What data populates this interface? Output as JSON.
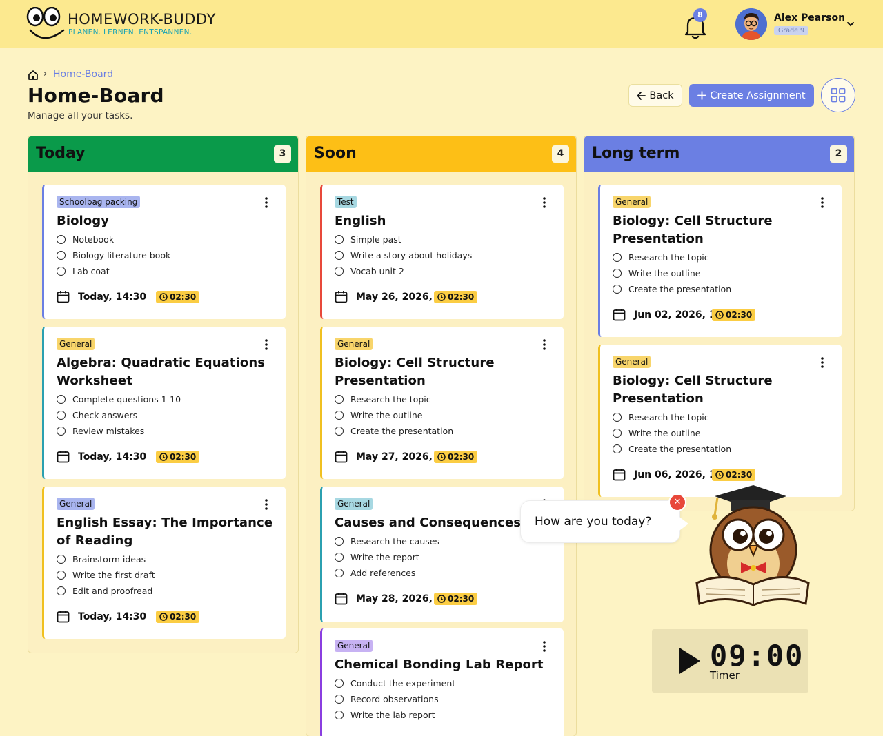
{
  "header": {
    "app_title": "HOMEWORK-BUDDY",
    "tagline": "PLANEN. LERNEN. ENTSPANNEN.",
    "notification_count": "8",
    "user_name": "Alex Pearson",
    "user_grade": "Grade 9"
  },
  "breadcrumb": {
    "current": "Home-Board"
  },
  "page": {
    "title": "Home-Board",
    "subtitle": "Manage all your tasks."
  },
  "actions": {
    "back_label": "Back",
    "create_label": "Create Assignment"
  },
  "colors": {
    "accent": "#6b7fe3",
    "today": "#0a9a4a",
    "soon": "#fdbf16",
    "long_term": "#6b7fe3",
    "duration_badge": "#fbcd44"
  },
  "columns": [
    {
      "title": "Today",
      "count": "3",
      "cards": [
        {
          "tag": "Schoolbag packing",
          "title": "Biology",
          "subtasks": [
            "Notebook",
            "Biology literature book",
            "Lab coat"
          ],
          "due": "Today, 14:30",
          "duration": "02:30"
        },
        {
          "tag": "General",
          "title": "Algebra: Quadratic Equations Worksheet",
          "subtasks": [
            "Complete questions 1-10",
            "Check answers",
            "Review mistakes"
          ],
          "due": "Today, 14:30",
          "duration": "02:30"
        },
        {
          "tag": "General",
          "title": "English Essay: The Importance of Reading",
          "subtasks": [
            "Brainstorm ideas",
            "Write the first draft",
            "Edit and proofread"
          ],
          "due": "Today, 14:30",
          "duration": "02:30"
        }
      ]
    },
    {
      "title": "Soon",
      "count": "4",
      "cards": [
        {
          "tag": "Test",
          "title": "English",
          "subtasks": [
            "Simple past",
            "Write a story about holidays",
            "Vocab unit 2"
          ],
          "due": "May 26, 2026, 14:30",
          "duration": "02:30"
        },
        {
          "tag": "General",
          "title": "Biology: Cell Structure Presentation",
          "subtasks": [
            "Research the topic",
            "Write the outline",
            "Create the presentation"
          ],
          "due": "May 27, 2026, 14:30",
          "duration": "02:30"
        },
        {
          "tag": "General",
          "title": "Causes and Consequences Report",
          "subtasks": [
            "Research the causes",
            "Write the report",
            "Add references"
          ],
          "due": "May 28, 2026, 14:30",
          "duration": "02:30"
        },
        {
          "tag": "General",
          "title": "Chemical Bonding Lab Report",
          "subtasks": [
            "Conduct the experiment",
            "Record observations",
            "Write the lab report"
          ]
        }
      ]
    },
    {
      "title": "Long term",
      "count": "2",
      "cards": [
        {
          "tag": "General",
          "title": "Biology: Cell Structure Presentation",
          "subtasks": [
            "Research the topic",
            "Write the outline",
            "Create the presentation"
          ],
          "due": "Jun 02, 2026, 14:30",
          "duration": "02:30"
        },
        {
          "tag": "General",
          "title": "Biology: Cell Structure Presentation",
          "subtasks": [
            "Research the topic",
            "Write the outline",
            "Create the presentation"
          ],
          "due": "Jun 06, 2026, 14:30",
          "duration": "02:30"
        }
      ]
    }
  ],
  "assistant": {
    "message": "How are you today?"
  },
  "timer": {
    "time": "09:00",
    "label": "Timer"
  }
}
